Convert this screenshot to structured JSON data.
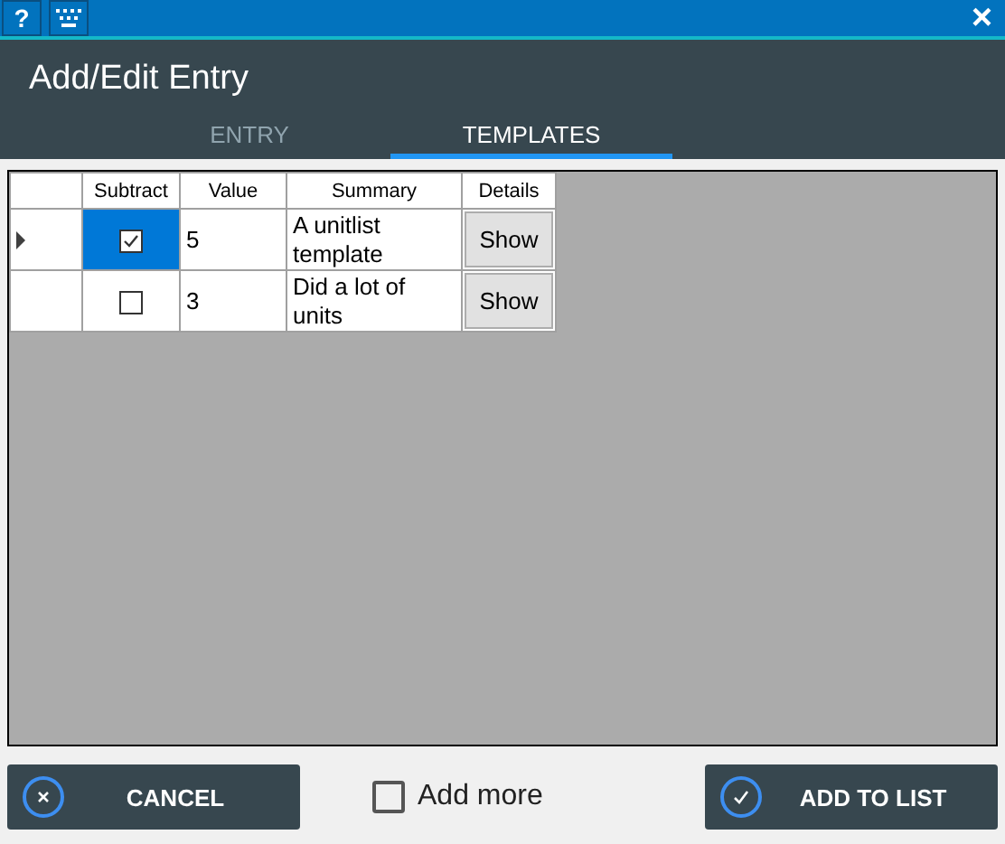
{
  "title_bar": {
    "help": "?",
    "close": "×"
  },
  "header": {
    "title": "Add/Edit Entry"
  },
  "tabs": [
    {
      "label": "ENTRY",
      "selected": false
    },
    {
      "label": "TEMPLATES",
      "selected": true
    }
  ],
  "table": {
    "columns": [
      "Subtract",
      "Value",
      "Summary",
      "Details"
    ],
    "rows": [
      {
        "selected": true,
        "subtract": true,
        "value": "5",
        "summary": "A unitlist template",
        "details": "Show"
      },
      {
        "selected": false,
        "subtract": false,
        "value": "3",
        "summary": "Did a lot of units",
        "details": "Show"
      }
    ]
  },
  "footer": {
    "cancel": "CANCEL",
    "add_more": {
      "label": "Add more",
      "checked": false
    },
    "add_to_list": "ADD TO LIST"
  }
}
